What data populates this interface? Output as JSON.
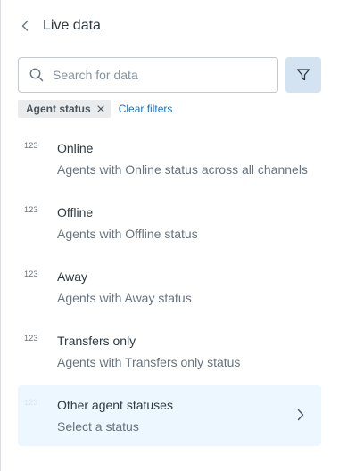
{
  "header": {
    "title": "Live data"
  },
  "search": {
    "placeholder": "Search for data",
    "value": ""
  },
  "filters": {
    "chips": [
      {
        "label": "Agent status"
      }
    ],
    "clear_label": "Clear filters"
  },
  "items": [
    {
      "type": "123",
      "title": "Online",
      "description": "Agents with Online status across all channels"
    },
    {
      "type": "123",
      "title": "Offline",
      "description": "Agents with Offline status"
    },
    {
      "type": "123",
      "title": "Away",
      "description": "Agents with Away status"
    },
    {
      "type": "123",
      "title": "Transfers only",
      "description": "Agents with Transfers only status"
    },
    {
      "type": "123",
      "title": "Other agent statuses",
      "description": "Select a status"
    }
  ],
  "colors": {
    "accent": "#1f73b7",
    "filter_button_bg": "#d4e3f1",
    "highlight_bg": "#edf7ff",
    "chip_bg": "#e9ebed"
  },
  "icons": {
    "back": "chevron-left-icon",
    "search": "search-icon",
    "filter": "filter-icon",
    "chip_remove": "close-icon",
    "item_next": "chevron-right-icon"
  }
}
